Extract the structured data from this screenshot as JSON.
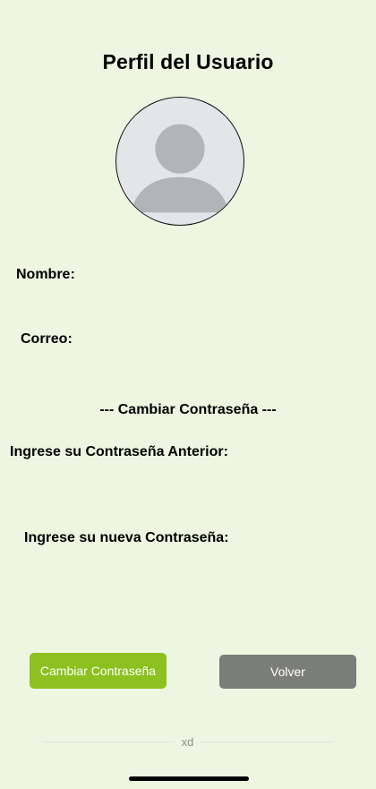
{
  "header": {
    "title": "Perfil del Usuario"
  },
  "profile": {
    "avatar_icon": "user-silhouette-icon",
    "nombre_label": "Nombre:",
    "correo_label": "Correo:"
  },
  "password_section": {
    "title": "--- Cambiar Contraseña ---",
    "old_password_label": "Ingrese su Contraseña Anterior:",
    "new_password_label": "Ingrese su nueva Contraseña:"
  },
  "actions": {
    "change_password_button": "Cambiar Contraseña",
    "back_button": "Volver"
  },
  "footer": {
    "text": "xd"
  },
  "colors": {
    "background": "#edf6e1",
    "primary_button": "#8cc11f",
    "secondary_button": "#7b7d79"
  }
}
